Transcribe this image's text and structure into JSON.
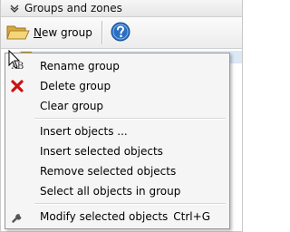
{
  "panel": {
    "title": "Groups and zones"
  },
  "toolbar": {
    "new_group_mnemonic": "N",
    "new_group_rest": "ew group",
    "help_icon": "help-icon"
  },
  "context_menu": {
    "rename_icon_text": "AB",
    "items": [
      {
        "label": "Rename group",
        "icon": "rename-icon",
        "shortcut": ""
      },
      {
        "label": "Delete group",
        "icon": "delete-icon",
        "shortcut": ""
      },
      {
        "label": "Clear group",
        "icon": "",
        "shortcut": ""
      },
      {
        "label": "Insert objects ...",
        "icon": "",
        "shortcut": ""
      },
      {
        "label": "Insert selected objects",
        "icon": "",
        "shortcut": ""
      },
      {
        "label": "Remove selected objects",
        "icon": "",
        "shortcut": ""
      },
      {
        "label": "Select all objects in group",
        "icon": "",
        "shortcut": ""
      },
      {
        "label": "Modify selected objects",
        "icon": "wrench-icon",
        "shortcut": "Ctrl+G"
      }
    ]
  },
  "colors": {
    "delete_icon": "#cc1111",
    "help_icon": "#2b6fc2",
    "folder_icon": "#e9c25a"
  }
}
